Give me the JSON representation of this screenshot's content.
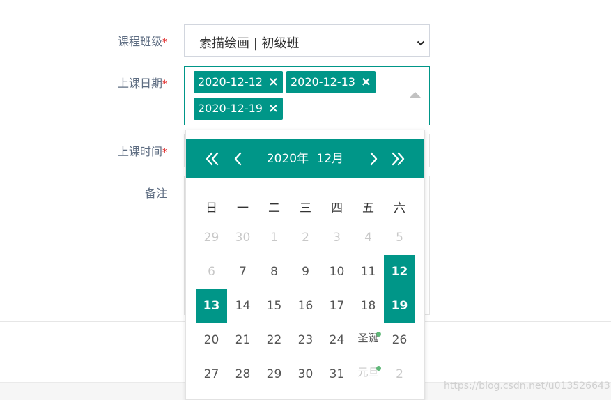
{
  "form": {
    "course": {
      "label": "课程班级",
      "required_mark": "*",
      "value": "素描绘画 | 初级班"
    },
    "dates": {
      "label": "上课日期",
      "required_mark": "*",
      "tags": [
        {
          "text": "2020-12-12",
          "close": "×"
        },
        {
          "text": "2020-12-13",
          "close": "×"
        },
        {
          "text": "2020-12-19",
          "close": "×"
        }
      ]
    },
    "time": {
      "label": "上课时间",
      "required_mark": "*"
    },
    "remark": {
      "label": "备注"
    }
  },
  "calendar": {
    "year": "2020年",
    "month": "12月",
    "weekdays": [
      "日",
      "一",
      "二",
      "三",
      "四",
      "五",
      "六"
    ],
    "weeks": [
      [
        {
          "t": "29",
          "o": true
        },
        {
          "t": "30",
          "o": true
        },
        {
          "t": "1",
          "o": true
        },
        {
          "t": "2",
          "o": true
        },
        {
          "t": "3",
          "o": true
        },
        {
          "t": "4",
          "o": true
        },
        {
          "t": "5",
          "o": true
        }
      ],
      [
        {
          "t": "6",
          "o": true
        },
        {
          "t": "7"
        },
        {
          "t": "8"
        },
        {
          "t": "9"
        },
        {
          "t": "10"
        },
        {
          "t": "11"
        },
        {
          "t": "12",
          "sel": true
        }
      ],
      [
        {
          "t": "13",
          "sel": true
        },
        {
          "t": "14"
        },
        {
          "t": "15"
        },
        {
          "t": "16"
        },
        {
          "t": "17"
        },
        {
          "t": "18"
        },
        {
          "t": "19",
          "sel": true
        }
      ],
      [
        {
          "t": "20"
        },
        {
          "t": "21"
        },
        {
          "t": "22"
        },
        {
          "t": "23"
        },
        {
          "t": "24"
        },
        {
          "t": "圣诞",
          "fest": true
        },
        {
          "t": "26"
        }
      ],
      [
        {
          "t": "27"
        },
        {
          "t": "28"
        },
        {
          "t": "29"
        },
        {
          "t": "30"
        },
        {
          "t": "31"
        },
        {
          "t": "元旦",
          "fest": true,
          "o": true
        },
        {
          "t": "2",
          "o": true
        }
      ]
    ]
  },
  "colors": {
    "accent": "#009688",
    "festival_dot": "#5fb878",
    "required": "#e02020"
  },
  "watermark": "https://blog.csdn.net/u013526643"
}
